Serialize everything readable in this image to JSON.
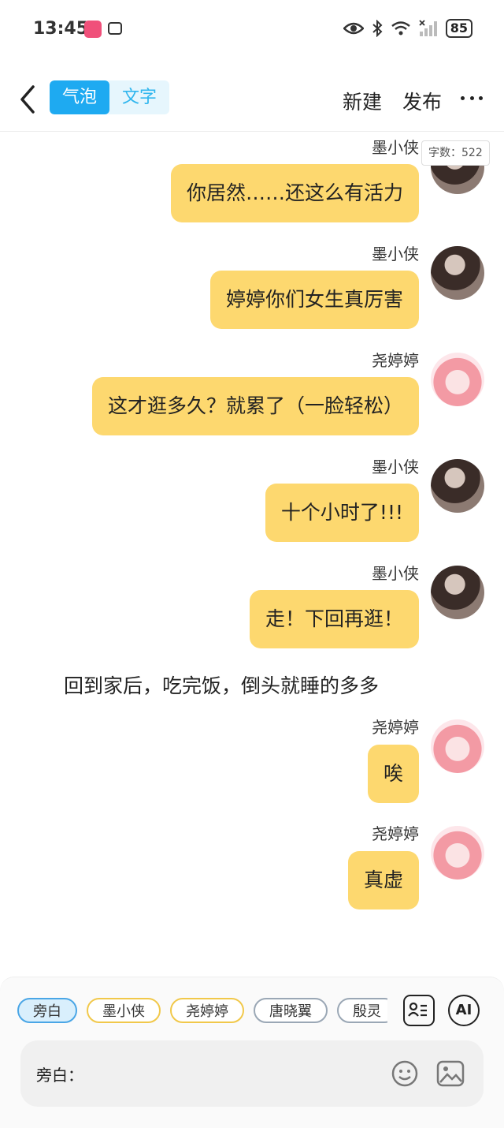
{
  "status_bar": {
    "time": "13:45",
    "battery": "85"
  },
  "header": {
    "tabs": [
      {
        "label": "气泡",
        "active": true
      },
      {
        "label": "文字",
        "active": false
      }
    ],
    "new_label": "新建",
    "publish_label": "发布"
  },
  "word_count": "字数：522",
  "messages": [
    {
      "name": "墨小侠",
      "text": "你居然……还这么有活力",
      "avatar": "boy-avatar"
    },
    {
      "name": "墨小侠",
      "text": "婷婷你们女生真厉害",
      "avatar": "boy-avatar"
    },
    {
      "name": "尧婷婷",
      "text": "这才逛多久？就累了（一脸轻松）",
      "avatar": "girl-avatar"
    },
    {
      "name": "墨小侠",
      "text": "十个小时了!!!",
      "avatar": "boy-avatar"
    },
    {
      "name": "墨小侠",
      "text": "走！下回再逛！",
      "avatar": "boy-avatar"
    },
    {
      "name": "尧婷婷",
      "text": "唉",
      "avatar": "girl-avatar"
    },
    {
      "name": "尧婷婷",
      "text": "真虚",
      "avatar": "girl-avatar"
    }
  ],
  "narration": "回到家后，吃完饭，倒头就睡的多多",
  "composer": {
    "roles": [
      {
        "label": "旁白",
        "style": "active"
      },
      {
        "label": "墨小侠",
        "style": "yellow"
      },
      {
        "label": "尧婷婷",
        "style": "yellow"
      },
      {
        "label": "唐晓翼",
        "style": "gray"
      },
      {
        "label": "殷灵",
        "style": "gray"
      }
    ],
    "ai_label": "AI",
    "input_prefix": "旁白：",
    "input_value": ""
  },
  "colors": {
    "bubble": "#fdd86f",
    "accent": "#1eaaf1"
  }
}
